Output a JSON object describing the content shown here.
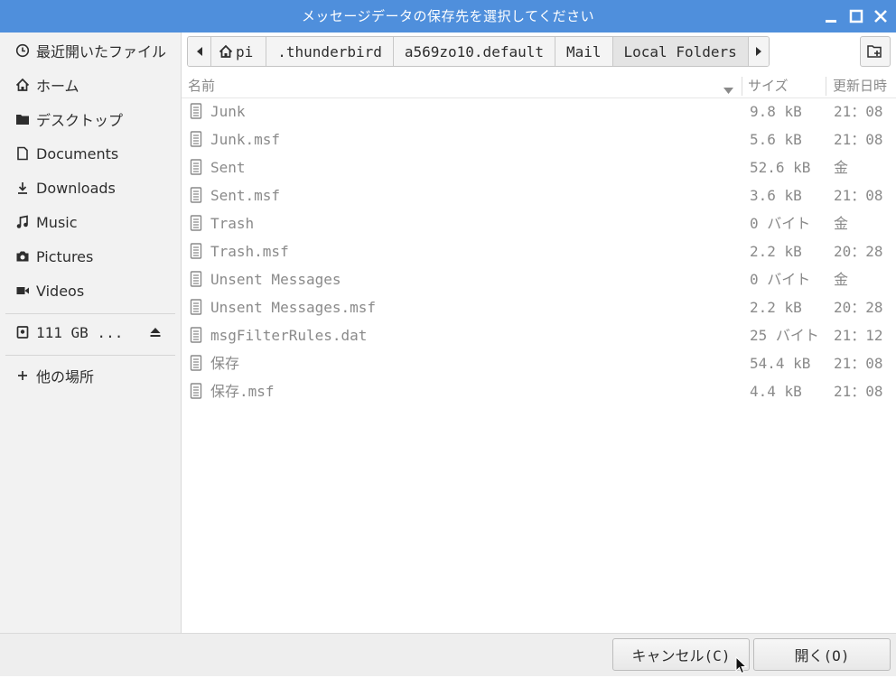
{
  "window": {
    "title": "メッセージデータの保存先を選択してください"
  },
  "sidebar": {
    "items": [
      {
        "label": "最近開いたファイル",
        "icon": "clock-icon"
      },
      {
        "label": "ホーム",
        "icon": "home-icon"
      },
      {
        "label": "デスクトップ",
        "icon": "folder-icon"
      },
      {
        "label": "Documents",
        "icon": "document-icon"
      },
      {
        "label": "Downloads",
        "icon": "download-icon"
      },
      {
        "label": "Music",
        "icon": "music-icon"
      },
      {
        "label": "Pictures",
        "icon": "camera-icon"
      },
      {
        "label": "Videos",
        "icon": "video-icon"
      }
    ],
    "drive": {
      "label": "111 GB ...",
      "icon": "drive-icon"
    },
    "other": {
      "label": "他の場所",
      "icon": "plus-icon"
    }
  },
  "pathbar": {
    "crumbs": [
      "pi",
      ".thunderbird",
      "a569zo10.default",
      "Mail",
      "Local Folders"
    ]
  },
  "filelist": {
    "headers": {
      "name": "名前",
      "size": "サイズ",
      "modified": "更新日時"
    },
    "files": [
      {
        "name": "Junk",
        "size": "9.8 kB",
        "modified": "21：08"
      },
      {
        "name": "Junk.msf",
        "size": "5.6 kB",
        "modified": "21：08"
      },
      {
        "name": "Sent",
        "size": "52.6 kB",
        "modified": "金"
      },
      {
        "name": "Sent.msf",
        "size": "3.6 kB",
        "modified": "21：08"
      },
      {
        "name": "Trash",
        "size": "0 バイト",
        "modified": "金"
      },
      {
        "name": "Trash.msf",
        "size": "2.2 kB",
        "modified": "20：28"
      },
      {
        "name": "Unsent Messages",
        "size": "0 バイト",
        "modified": "金"
      },
      {
        "name": "Unsent Messages.msf",
        "size": "2.2 kB",
        "modified": "20：28"
      },
      {
        "name": "msgFilterRules.dat",
        "size": "25 バイト",
        "modified": "21：12"
      },
      {
        "name": "保存",
        "size": "54.4 kB",
        "modified": "21：08"
      },
      {
        "name": "保存.msf",
        "size": "4.4 kB",
        "modified": "21：08"
      }
    ]
  },
  "buttons": {
    "cancel": "キャンセル(C)",
    "open": "開く(O)"
  },
  "colors": {
    "titlebar": "#4f8fdc",
    "sidebar": "#f2f2f2",
    "text": "#2e2e2e",
    "muted": "#8a8a8a"
  }
}
